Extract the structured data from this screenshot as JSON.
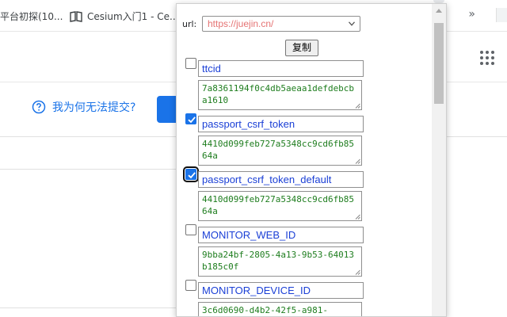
{
  "bookmarks": {
    "items": [
      {
        "label": "平台初探(10..."
      },
      {
        "label": "Cesium入门1 - Ce..."
      }
    ],
    "more_icon": "double-chevron-right-icon"
  },
  "page": {
    "help_text": "我为何无法提交?",
    "help_icon": "question-circle-icon",
    "accent_color": "#1a73e8"
  },
  "popup": {
    "url_label": "url:",
    "url_value": "https://juejin.cn/",
    "copy_label": "复制",
    "cookies": [
      {
        "name": "ttcid",
        "value": "7a8361194f0c4db5aeaa1defdebcba1610",
        "checked": false
      },
      {
        "name": "passport_csrf_token",
        "value": "4410d099feb727a5348cc9cd6fb8564a",
        "checked": true
      },
      {
        "name": "passport_csrf_token_default",
        "value": "4410d099feb727a5348cc9cd6fb8564a",
        "checked": true
      },
      {
        "name": "MONITOR_WEB_ID",
        "value": "9bba24bf-2805-4a13-9b53-64013b185c0f",
        "checked": false
      },
      {
        "name": "MONITOR_DEVICE_ID",
        "value": "3c6d0690-d4b2-42f5-a981-",
        "checked": false
      }
    ]
  }
}
